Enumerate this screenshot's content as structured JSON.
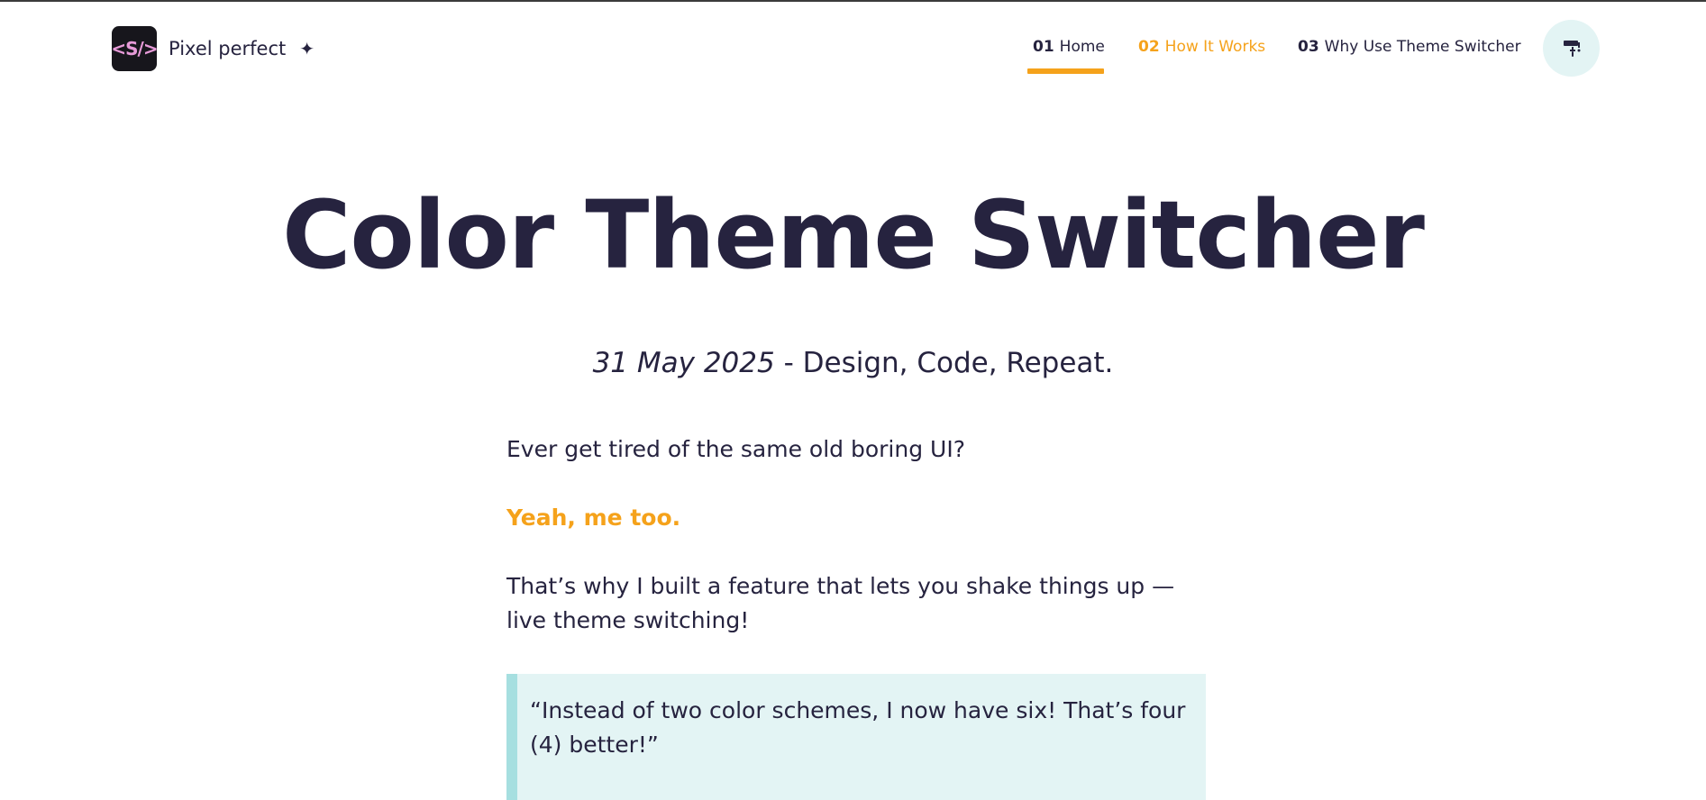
{
  "brand": {
    "logo_text": "<S/>",
    "name": "Pixel perfect",
    "sparkle_glyph": "✦",
    "sparkle_icon": "sparkle-icon"
  },
  "nav": {
    "items": [
      {
        "num": "01",
        "label": "Home",
        "active": true
      },
      {
        "num": "02",
        "label": "How It Works",
        "hover": true
      },
      {
        "num": "03",
        "label": "Why Use Theme Switcher"
      }
    ],
    "theme_button_icon": "paint-roller-icon"
  },
  "hero": {
    "title": "Color Theme Switcher",
    "date": "31 May 2025",
    "separator": " - ",
    "tagline": "Design, Code, Repeat."
  },
  "article": {
    "p1": "Ever get tired of the same old boring UI?",
    "p2": "Yeah, me too.",
    "p3": "That’s why I built a feature that lets you shake things up — live theme switching!",
    "quote": "“Instead of two color schemes, I now have six! That’s four (4) better!”"
  },
  "colors": {
    "text": "#26233f",
    "accent": "#f5a21b",
    "quote_bg": "#e3f4f4",
    "quote_border": "#a6dfe0",
    "logo_bg": "#17161c",
    "logo_text": "#e79ad8"
  }
}
